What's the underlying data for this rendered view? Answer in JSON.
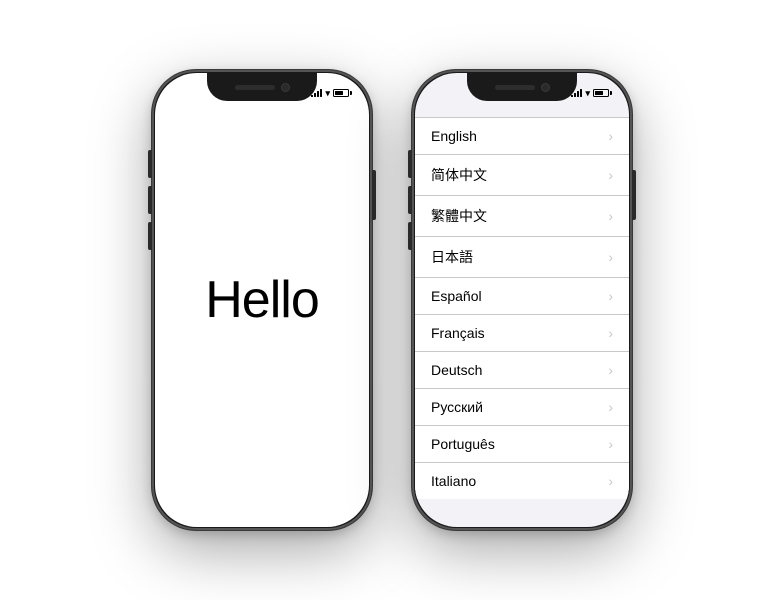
{
  "phones": {
    "left": {
      "status": {
        "time": "",
        "signal": [
          2,
          4,
          6,
          8,
          10
        ],
        "wifi": "WiFi",
        "battery": 70
      },
      "hello_text": "Hello"
    },
    "right": {
      "status": {
        "time": "",
        "signal": [
          2,
          4,
          6,
          8,
          10
        ],
        "wifi": "WiFi",
        "battery": 70
      },
      "languages": [
        {
          "name": "English",
          "chevron": ">"
        },
        {
          "name": "简体中文",
          "chevron": ">"
        },
        {
          "name": "繁體中文",
          "chevron": ">"
        },
        {
          "name": "日本語",
          "chevron": ">"
        },
        {
          "name": "Español",
          "chevron": ">"
        },
        {
          "name": "Français",
          "chevron": ">"
        },
        {
          "name": "Deutsch",
          "chevron": ">"
        },
        {
          "name": "Русский",
          "chevron": ">"
        },
        {
          "name": "Português",
          "chevron": ">"
        },
        {
          "name": "Italiano",
          "chevron": ">"
        }
      ]
    }
  }
}
